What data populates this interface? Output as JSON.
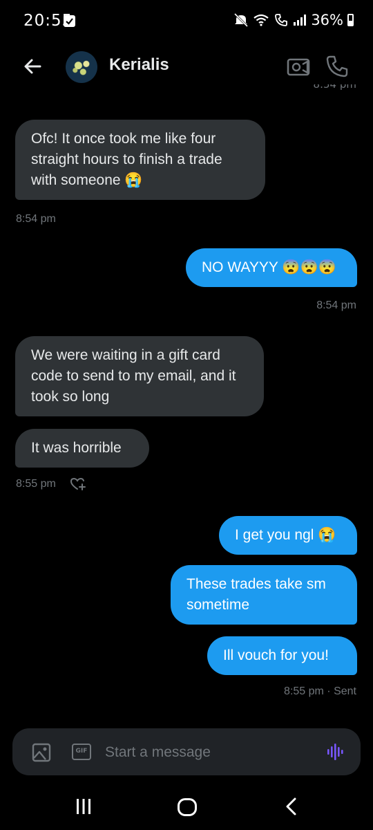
{
  "status_bar": {
    "time": "20:55",
    "battery": "36%",
    "icons": [
      "check-icon",
      "mute-icon",
      "wifi-icon",
      "volte-call-icon",
      "signal-icon",
      "battery-icon"
    ]
  },
  "header": {
    "contact_name": "Kerialis",
    "icons": [
      "back-arrow-icon",
      "avatar",
      "video-icon",
      "phone-icon"
    ]
  },
  "messages": [
    {
      "direction": "received",
      "text": "Ofc! It once took me like four straight hours to finish a trade with someone 😭"
    },
    {
      "direction": "received",
      "time": "8:54 pm"
    },
    {
      "direction": "sent",
      "text": "NO WAYYY 😨😨😨",
      "time": "8:54 pm"
    },
    {
      "direction": "received",
      "text": "We were waiting in a gift card code to send to my email, and it took so long"
    },
    {
      "direction": "received",
      "text": "It was horrible",
      "time": "8:55 pm"
    },
    {
      "direction": "sent",
      "text": "I get you ngl 😭"
    },
    {
      "direction": "sent",
      "text": "These trades take sm sometime"
    },
    {
      "direction": "sent",
      "text": "Ill vouch for you!",
      "time": "8:55 pm",
      "status": "Sent"
    }
  ],
  "meta": {
    "m1_time": "8:54 pm",
    "m2_time": "8:54 pm",
    "m5_time": "8:55 pm",
    "m8_time": "8:55 pm · Sent"
  },
  "composer": {
    "placeholder": "Start a message",
    "gif_label": "GIF",
    "icons": [
      "image-icon",
      "gif-icon",
      "voice-icon"
    ]
  },
  "nav": {
    "icons": [
      "recent-apps-icon",
      "home-icon",
      "back-icon"
    ]
  },
  "colors": {
    "background": "#000000",
    "received_bubble": "#2f3336",
    "sent_bubble": "#1d9bf0",
    "muted_text": "#71767b",
    "voice_accent": "#7856ff"
  }
}
